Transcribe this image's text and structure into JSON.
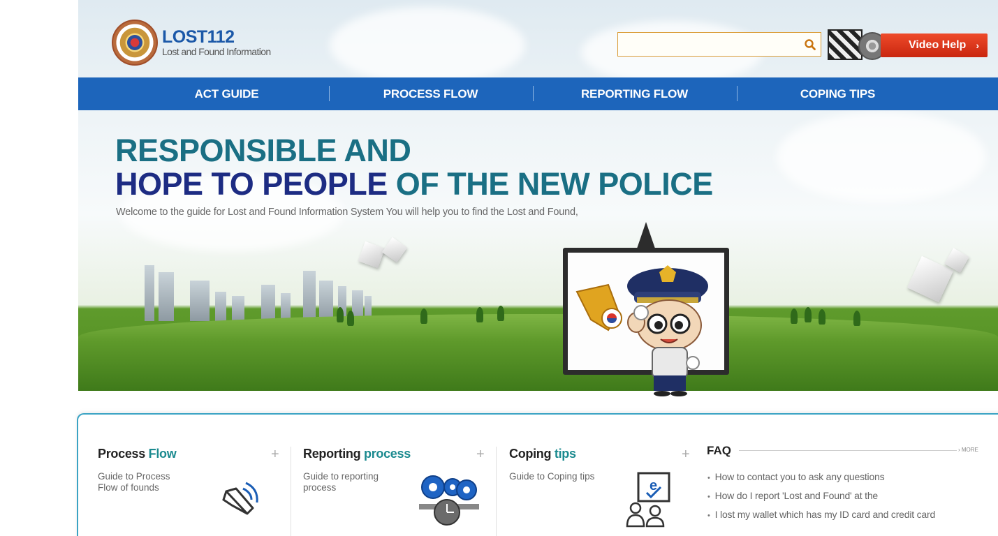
{
  "header": {
    "logo_title": "LOST112",
    "logo_subtitle": "Lost and Found Information",
    "search": {
      "value": "",
      "placeholder": ""
    },
    "video_help_label": "Video Help"
  },
  "nav": {
    "items": [
      {
        "label": "ACT GUIDE"
      },
      {
        "label": "PROCESS FLOW"
      },
      {
        "label": "REPORTING FLOW"
      },
      {
        "label": "COPING TIPS"
      }
    ]
  },
  "hero": {
    "line1": "RESPONSIBLE AND",
    "line2_part1": "HOPE TO PEOPLE",
    "line2_part2": "OF THE NEW POLICE",
    "subtitle": "Welcome to the guide for Lost and Found Information System You will help you to find the Lost and Found,"
  },
  "panel": {
    "columns": [
      {
        "title_plain": "Process ",
        "title_highlight": "Flow",
        "description": "Guide to Process Flow of founds",
        "icon": "speaker-icon"
      },
      {
        "title_plain": "Reporting ",
        "title_highlight": "process",
        "description": "Guide to reporting process",
        "icon": "gears-clock-icon"
      },
      {
        "title_plain": "Coping ",
        "title_highlight": "tips",
        "description": "Guide to Coping tips",
        "icon": "e-learning-icon"
      }
    ],
    "plus_symbol": "+",
    "faq": {
      "title": "FAQ",
      "more_label": "› MORE",
      "items": [
        "How to contact you to ask any questions",
        "How do I report 'Lost and Found' at the",
        "I lost my wallet which has my ID card and credit card"
      ]
    }
  },
  "colors": {
    "nav_blue": "#1d65bb",
    "hero_teal": "#1a6f84",
    "hero_navy": "#1d2c83",
    "video_red": "#e0401f",
    "panel_border": "#3aa3c4"
  }
}
